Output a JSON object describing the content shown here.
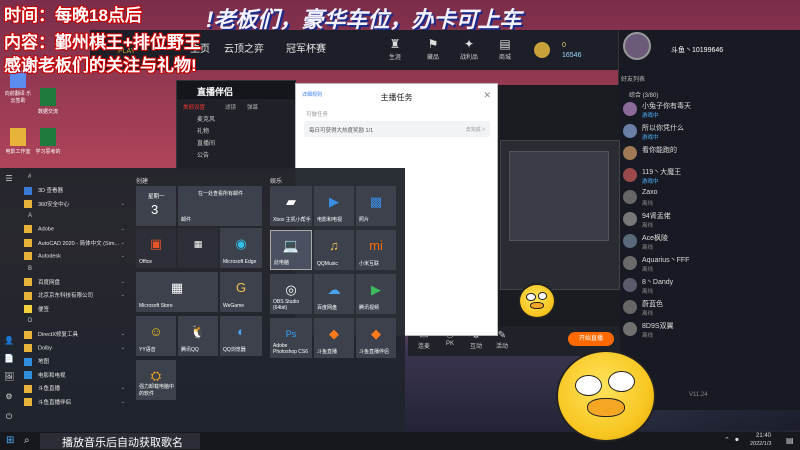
{
  "overlay": {
    "line1": "时间：每晚18点后",
    "line2": "内容：鄞州棋王+排位野王",
    "line3": "感谢老板们的关注与礼物!",
    "marquee": "!老板们，豪华车位，办卡可上车"
  },
  "game": {
    "tabs": [
      "主页",
      "云顶之弈",
      "冠军杯赛"
    ],
    "play_label": "PLAY",
    "icons": [
      {
        "name": "profile",
        "label": "生涯"
      },
      {
        "name": "collection",
        "label": "藏品"
      },
      {
        "name": "tactics",
        "label": "战利品"
      },
      {
        "name": "shop",
        "label": "商城"
      }
    ],
    "currency1": "0",
    "currency2": "16546",
    "user": "斗鱼丶10199646"
  },
  "chat": {
    "header": "好友列表",
    "group": "综合 (3/80)",
    "entries": [
      {
        "name": "小兔子你有毒天",
        "status": "游戏中"
      },
      {
        "name": "所以你凭什么",
        "status": "游戏中"
      },
      {
        "name": "看你能跑的",
        "status": ""
      },
      {
        "name": "119丶大魔王",
        "status": "游戏中"
      },
      {
        "name": "Zaxo",
        "status": "离线"
      },
      {
        "name": "94肾盂佬",
        "status": "离线"
      },
      {
        "name": "Ace枫陵",
        "status": "离线"
      },
      {
        "name": "Aquarius丶FFF",
        "status": "离线"
      },
      {
        "name": "8丶Dandy",
        "status": "离线"
      },
      {
        "name": "蔚蓝色",
        "status": "离线"
      },
      {
        "name": "8D9S双翼",
        "status": "离线"
      }
    ],
    "time": "V11.24"
  },
  "helper": {
    "title": "直播伴侣",
    "tabs": [
      "美颜设置",
      "滤镜",
      "弹幕",
      "设置"
    ],
    "rows": [
      "麦克风",
      "礼物",
      "直播间",
      "公告"
    ]
  },
  "task_dialog": {
    "link": "详细规则",
    "title": "主播任务",
    "section": "可做任务",
    "item_text": "每日可获得大热度奖励 1/1",
    "item_action": "去完成 >"
  },
  "stream_controls": [
    "开始直播",
    "连麦",
    "PK",
    "互动",
    "活动",
    "设置"
  ],
  "start_live": "开始直播",
  "desktop_icons": [
    {
      "label": "向前翻译 乐 云签助"
    },
    {
      "label": "数据交流"
    },
    {
      "label": "电影工作室"
    },
    {
      "label": "学习思考的"
    }
  ],
  "start_menu": {
    "left_rail": [
      "☰",
      "👤",
      "📄",
      "🖼",
      "⚙",
      "⏻"
    ],
    "apps": [
      {
        "letter": "#",
        "label": ""
      },
      {
        "label": "3D 查看器",
        "color": "#3a7bd5",
        "arrow": false
      },
      {
        "label": "360安全中心",
        "color": "#e8b33a",
        "arrow": true
      },
      {
        "letter": "A",
        "label": ""
      },
      {
        "label": "Adobe",
        "color": "#e8b33a",
        "arrow": true
      },
      {
        "label": "AutoCAD 2020 - 简体中文 (Sim...",
        "color": "#e8b33a",
        "arrow": true
      },
      {
        "label": "Autodesk",
        "color": "#e8b33a",
        "arrow": true
      },
      {
        "letter": "B",
        "label": ""
      },
      {
        "label": "百度网盘",
        "color": "#e8b33a",
        "arrow": true
      },
      {
        "label": "北京京东科技有限公司",
        "color": "#e8b33a",
        "arrow": true
      },
      {
        "label": "便签",
        "color": "#f2d13a",
        "arrow": false
      },
      {
        "letter": "D",
        "label": ""
      },
      {
        "label": "DirectX修复工具",
        "color": "#e8b33a",
        "arrow": true
      },
      {
        "label": "Dolby",
        "color": "#e8b33a",
        "arrow": true
      },
      {
        "label": "地图",
        "color": "#2f8fdd",
        "arrow": false
      },
      {
        "label": "电影和电视",
        "color": "#2f8fdd",
        "arrow": false
      },
      {
        "label": "斗鱼直播",
        "color": "#e8b33a",
        "arrow": true
      },
      {
        "label": "斗鱼直播伴侣",
        "color": "#e8b33a",
        "arrow": true
      }
    ],
    "group_create": "创建",
    "group_play": "娱乐",
    "tiles": {
      "calendar_day": "星期一",
      "calendar_num": "3",
      "mail_header": "在一处查看所有邮件",
      "mail_label": "邮件",
      "office": "Office",
      "edge": "Microsoft Edge",
      "store": "Microsoft Store",
      "wegame": "WeGame",
      "yy": "YY语音",
      "qq": "腾讯QQ",
      "qqbrowser": "QQ浏览器",
      "helper": "强力卸载电脑中的软件",
      "xbox": "Xbox 主机小帮手",
      "movies": "电影和电视",
      "photos": "照片",
      "laptop": "此电脑",
      "qqmusic": "QQMusic",
      "xiaomi": "小米互联",
      "obs": "OBS Studio (64bit)",
      "baidu": "百度网盘",
      "tencentvideo": "腾讯视频",
      "ps": "Adobe Photoshop CS6",
      "douyu": "斗鱼直播",
      "douyuhelper": "斗鱼直播伴侣"
    }
  },
  "taskbar": {
    "search_text": "播放音乐后自动获取歌名",
    "time": "21:40",
    "date": "2022/1/3"
  }
}
